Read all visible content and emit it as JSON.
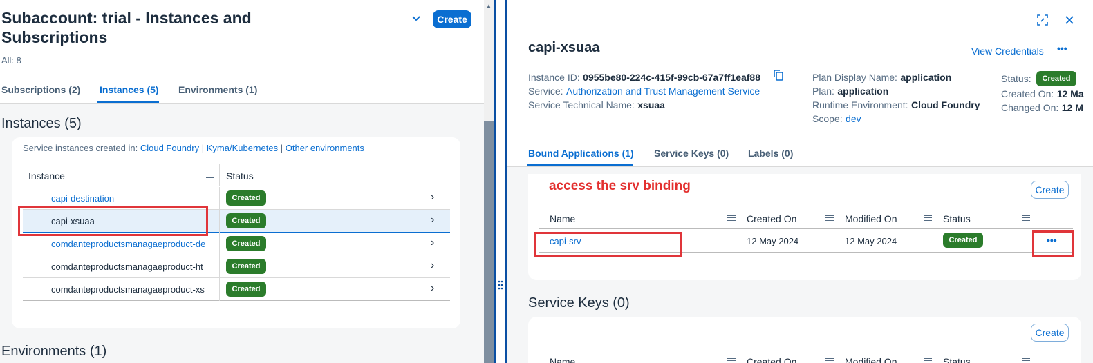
{
  "left": {
    "title_line1": "Subaccount: trial - Instances and",
    "title_line2": "Subscriptions",
    "count": "All: 8",
    "create_label": "Create",
    "tabs": [
      {
        "label": "Subscriptions (2)"
      },
      {
        "label": "Instances (5)"
      },
      {
        "label": "Environments (1)"
      }
    ],
    "instances_title": "Instances (5)",
    "created_in_label": "Service instances created in:",
    "created_in_links": [
      "Cloud Foundry",
      "Kyma/Kubernetes",
      "Other environments"
    ],
    "separator": "|",
    "columns": {
      "instance": "Instance",
      "status": "Status"
    },
    "rows": [
      {
        "name": "capi-destination",
        "status": "Created"
      },
      {
        "name": "capi-xsuaa",
        "status": "Created"
      },
      {
        "name": "comdanteproductsmanagaeproduct-de",
        "status": "Created"
      },
      {
        "name": "comdanteproductsmanagaeproduct-ht",
        "status": "Created"
      },
      {
        "name": "comdanteproductsmanagaeproduct-xs",
        "status": "Created"
      }
    ],
    "environments_title": "Environments (1)"
  },
  "right": {
    "title": "capi-xsuaa",
    "view_credentials": "View Credentials",
    "more": "•••",
    "fields": {
      "instance_id_label": "Instance ID:",
      "instance_id": "0955be80-224c-415f-99cb-67a7ff1eaf88",
      "service_label": "Service:",
      "service": "Authorization and Trust Management Service",
      "tech_name_label": "Service Technical Name:",
      "tech_name": "xsuaa",
      "plan_display_label": "Plan Display Name:",
      "plan_display": "application",
      "plan_label": "Plan:",
      "plan": "application",
      "runtime_label": "Runtime Environment:",
      "runtime": "Cloud Foundry",
      "scope_label": "Scope:",
      "scope": "dev",
      "status_label": "Status:",
      "status": "Created",
      "created_on_label": "Created On:",
      "created_on": "12 Ma",
      "changed_on_label": "Changed On:",
      "changed_on": "12 M"
    },
    "tabs": [
      {
        "label": "Bound Applications (1)"
      },
      {
        "label": "Service Keys (0)"
      },
      {
        "label": "Labels (0)"
      }
    ],
    "annotation": "access the srv binding",
    "create_label": "Create",
    "columns": {
      "name": "Name",
      "created_on": "Created On",
      "modified_on": "Modified On",
      "status": "Status"
    },
    "bound_rows": [
      {
        "name": "capi-srv",
        "created_on": "12 May 2024",
        "modified_on": "12 May 2024",
        "status": "Created"
      }
    ],
    "service_keys_title": "Service Keys (0)",
    "sk_create_label": "Create",
    "sk_columns": {
      "name": "Name",
      "created_on": "Created On",
      "modified_on": "Modified On",
      "status": "Status"
    }
  },
  "colors": {
    "accent": "#0a6ed1",
    "success": "#2b7c2b",
    "annotation": "#e3302f"
  }
}
